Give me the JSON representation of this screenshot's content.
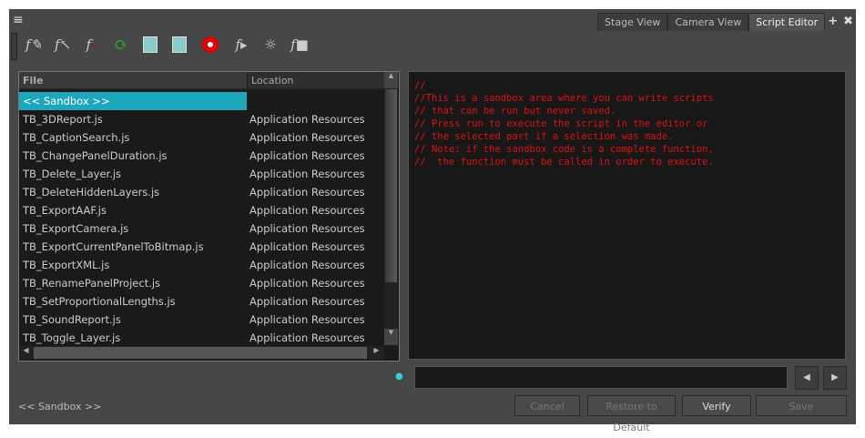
{
  "tabs": [
    {
      "label": "Stage View"
    },
    {
      "label": "Camera View"
    },
    {
      "label": "Script Editor",
      "active": true
    }
  ],
  "toolbar": [
    "new-function-icon",
    "import-function-icon",
    "delete-function-icon",
    "refresh-icon",
    "set-target-icon",
    "set-target-preview-icon",
    "target-icon",
    "run-icon",
    "debug-icon",
    "stop-icon"
  ],
  "list": {
    "headers": {
      "file": "File",
      "location": "Location"
    },
    "rows": [
      {
        "file": "<< Sandbox >>",
        "location": ""
      },
      {
        "file": "TB_3DReport.js",
        "location": "Application Resources"
      },
      {
        "file": "TB_CaptionSearch.js",
        "location": "Application Resources"
      },
      {
        "file": "TB_ChangePanelDuration.js",
        "location": "Application Resources"
      },
      {
        "file": "TB_Delete_Layer.js",
        "location": "Application Resources"
      },
      {
        "file": "TB_DeleteHiddenLayers.js",
        "location": "Application Resources"
      },
      {
        "file": "TB_ExportAAF.js",
        "location": "Application Resources"
      },
      {
        "file": "TB_ExportCamera.js",
        "location": "Application Resources"
      },
      {
        "file": "TB_ExportCurrentPanelToBitmap.js",
        "location": "Application Resources"
      },
      {
        "file": "TB_ExportXML.js",
        "location": "Application Resources"
      },
      {
        "file": "TB_RenamePanelProject.js",
        "location": "Application Resources"
      },
      {
        "file": "TB_SetProportionalLengths.js",
        "location": "Application Resources"
      },
      {
        "file": "TB_SoundReport.js",
        "location": "Application Resources"
      },
      {
        "file": "TB_Toggle_Layer.js",
        "location": "Application Resources"
      }
    ]
  },
  "editor": {
    "code": "//\n//This is a sandbox area where you can write scripts\n// that can be run but never saved.\n// Press run to execute the script in the editor or\n// the selected part if a selection was made.\n// Note: if the sandbox code is a complete function,\n//  the function must be called in order to execute.",
    "color": "#e01010"
  },
  "search": {
    "value": ""
  },
  "status": "<< Sandbox >>",
  "buttons": {
    "cancel": "Cancel",
    "restore": "Restore to Default",
    "verify": "Verify",
    "save": "Save"
  }
}
